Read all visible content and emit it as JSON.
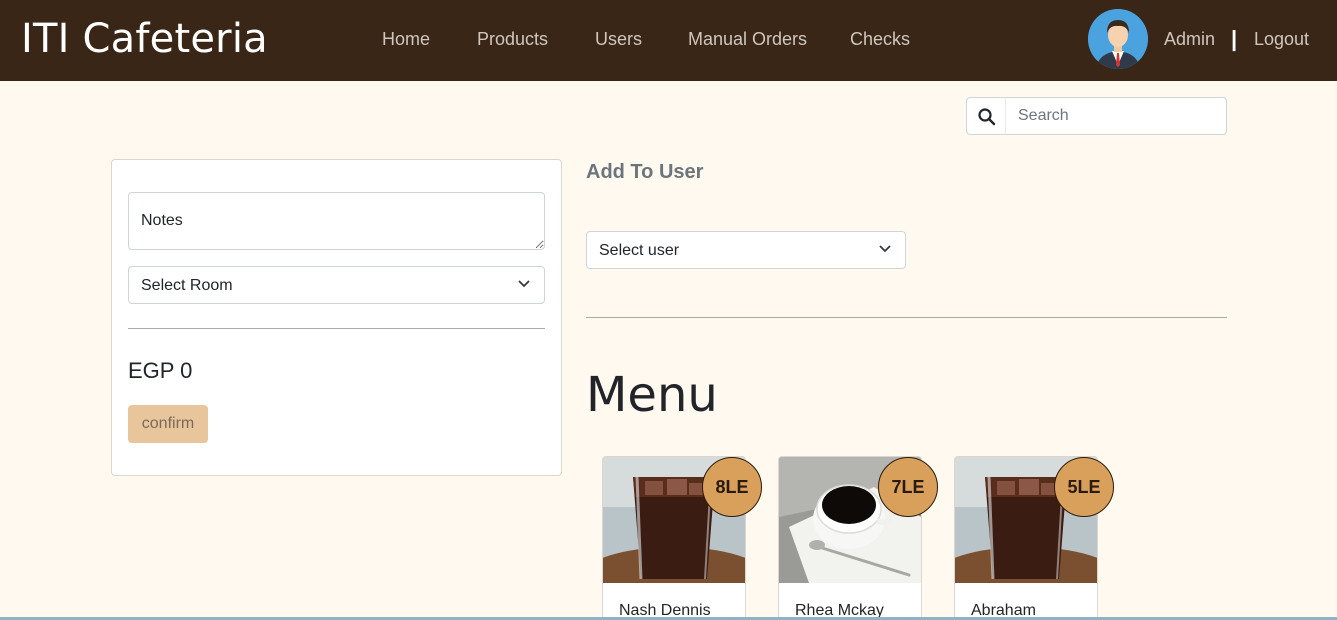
{
  "navbar": {
    "brand": "ITI Cafeteria",
    "links": [
      "Home",
      "Products",
      "Users",
      "Manual Orders",
      "Checks"
    ],
    "user_name": "Admin",
    "separator": "|",
    "logout": "Logout"
  },
  "search": {
    "placeholder": "Search"
  },
  "order": {
    "notes_placeholder": "Notes",
    "room_select": "Select Room",
    "total": "EGP 0",
    "confirm_label": "confirm"
  },
  "add_user": {
    "title": "Add To User",
    "user_select": "Select user"
  },
  "menu": {
    "title": "Menu",
    "products": [
      {
        "name": "Nash Dennis",
        "price": "8LE",
        "image": "iced-cola-glass"
      },
      {
        "name": "Rhea Mckay",
        "price": "7LE",
        "image": "black-coffee-cup"
      },
      {
        "name": "Abraham",
        "price": "5LE",
        "image": "iced-cola-glass"
      }
    ]
  },
  "colors": {
    "navbar_bg": "#3a2617",
    "page_bg": "#fff9ef",
    "confirm_bg": "#e8c59b",
    "price_badge_bg": "#d9a05b"
  }
}
